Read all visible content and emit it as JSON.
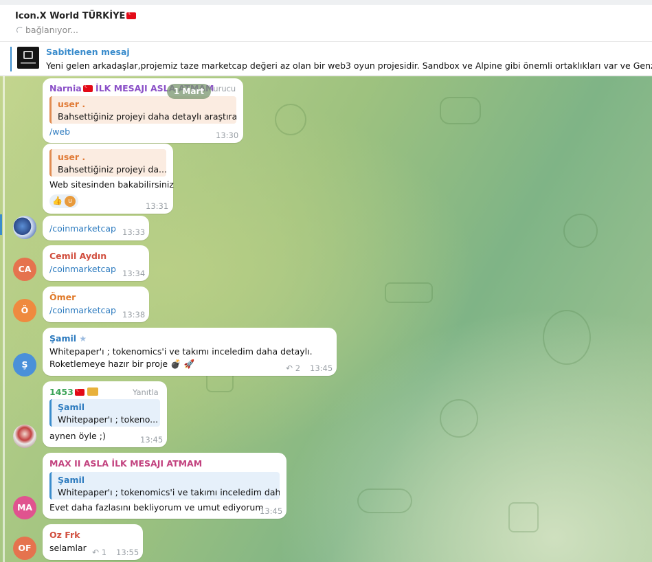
{
  "chat_header": {
    "title": "Icon.X World TÜRKİYE",
    "status": "bağlanıyor..."
  },
  "pinned": {
    "label": "Sabitlenen mesaj",
    "text": "Yeni gelen arkadaşlar,projemiz taze marketcap değeri az olan bir web3 oyun projesidir. Sandbox ve Alpine gibi önemli ortaklıkları var ve Genzo projeni"
  },
  "date_pill": "1 Mart",
  "messages": [
    {
      "name": "Narnia",
      "name_suffix": " İLK MESAJI ASLA ATMAM",
      "role": "kurucu",
      "reply_name": "user .",
      "reply_text": "Bahsettiğiniz projeyi daha detaylı araştıra...",
      "text": "/web",
      "time": "13:30"
    },
    {
      "reply_name": "user .",
      "reply_text": "Bahsettiğiniz projeyi da...",
      "text": "Web sitesinden bakabilirsiniz",
      "reactions": [
        "👍",
        "u"
      ],
      "time": "13:31"
    },
    {
      "text": "/coinmarketcap",
      "time": "13:33"
    },
    {
      "avatar": "CA",
      "name": "Cemil Aydın",
      "text": "/coinmarketcap",
      "time": "13:34"
    },
    {
      "avatar": "Ö",
      "name": "Ömer",
      "text": "/coinmarketcap",
      "time": "13:38"
    },
    {
      "avatar": "Ş",
      "name": "Şamil",
      "line1": "Whitepaper'ı ; tokenomics'i ve takımı inceledim daha detaylı.",
      "line2": "Roketlemeye hazır bir proje 💣 🚀",
      "replies": "2",
      "time": "13:45"
    },
    {
      "name": "1453",
      "role": "Yanıtla",
      "reply_name": "Şamil",
      "reply_text": "Whitepaper'ı ; tokeno...",
      "text": "aynen öyle ;)",
      "time": "13:45"
    },
    {
      "avatar": "MA",
      "name": "MAX II ASLA İLK MESAJI ATMAM",
      "reply_name": "Şamil",
      "reply_text": "Whitepaper'ı ; tokenomics'i ve takımı inceledim daha...",
      "text": "Evet daha fazlasını bekliyorum ve umut ediyorum",
      "time": "13:45"
    },
    {
      "avatar": "OF",
      "name": "Oz Frk",
      "text": "selamlar",
      "replies": "1",
      "time": "13:55"
    }
  ],
  "colors": {
    "accent": "#3a8ccc",
    "link": "#2d7bbf"
  }
}
